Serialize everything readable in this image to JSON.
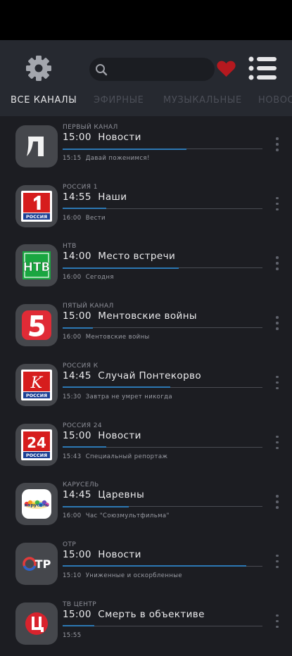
{
  "header": {
    "search_placeholder": "",
    "tabs": [
      {
        "label": "ВСЕ КАНАЛЫ",
        "active": true
      },
      {
        "label": "ЭФИРНЫЕ",
        "active": false
      },
      {
        "label": "МУЗЫКАЛЬНЫЕ",
        "active": false
      },
      {
        "label": "НОВОСТ",
        "active": false
      }
    ]
  },
  "colors": {
    "accent": "#2c78b4",
    "favorite": "#b5191f",
    "background": "#1c1d22"
  },
  "channels": [
    {
      "name": "ПЕРВЫЙ КАНАЛ",
      "now_time": "15:00",
      "now_title": "Новости",
      "progress": 0.62,
      "next_time": "15:15",
      "next_title": "Давай поженимся!",
      "logo_icon": "perviy-kanal-logo"
    },
    {
      "name": "РОССИЯ 1",
      "now_time": "14:55",
      "now_title": "Наши",
      "progress": 0.22,
      "next_time": "16:00",
      "next_title": "Вести",
      "logo_icon": "rossiya-1-logo",
      "logo_caption": "РОССИЯ"
    },
    {
      "name": "НТВ",
      "now_time": "14:00",
      "now_title": "Место встречи",
      "progress": 0.58,
      "next_time": "16:00",
      "next_title": "Сегодня",
      "logo_icon": "ntv-logo"
    },
    {
      "name": "ПЯТЫЙ КАНАЛ",
      "now_time": "15:00",
      "now_title": "Ментовские войны",
      "progress": 0.15,
      "next_time": "16:00",
      "next_title": "Ментовские войны",
      "logo_icon": "5-kanal-logo"
    },
    {
      "name": "РОССИЯ К",
      "now_time": "14:45",
      "now_title": "Случай Понтекорво",
      "progress": 0.54,
      "next_time": "15:30",
      "next_title": "Завтра не умрет никогда",
      "logo_icon": "rossiya-k-logo",
      "logo_caption": "РОССИЯ"
    },
    {
      "name": "РОССИЯ 24",
      "now_time": "15:00",
      "now_title": "Новости",
      "progress": 0.22,
      "next_time": "15:43",
      "next_title": "Специальный репортаж",
      "logo_icon": "rossiya-24-logo",
      "logo_caption": "РОССИЯ"
    },
    {
      "name": "КАРУСЕЛЬ",
      "now_time": "14:45",
      "now_title": "Царевны",
      "progress": 0.33,
      "next_time": "16:00",
      "next_title": "Час \"Союзмультфильма\"",
      "logo_icon": "karusel-logo"
    },
    {
      "name": "ОТР",
      "now_time": "15:00",
      "now_title": "Новости",
      "progress": 0.92,
      "next_time": "15:10",
      "next_title": "Униженные и оскорбленные",
      "logo_icon": "otr-logo"
    },
    {
      "name": "ТВ ЦЕНТР",
      "now_time": "15:00",
      "now_title": "Смерть в объективе",
      "progress": 0.16,
      "next_time": "15:55",
      "next_title": "",
      "logo_icon": "tv-centr-logo"
    }
  ]
}
